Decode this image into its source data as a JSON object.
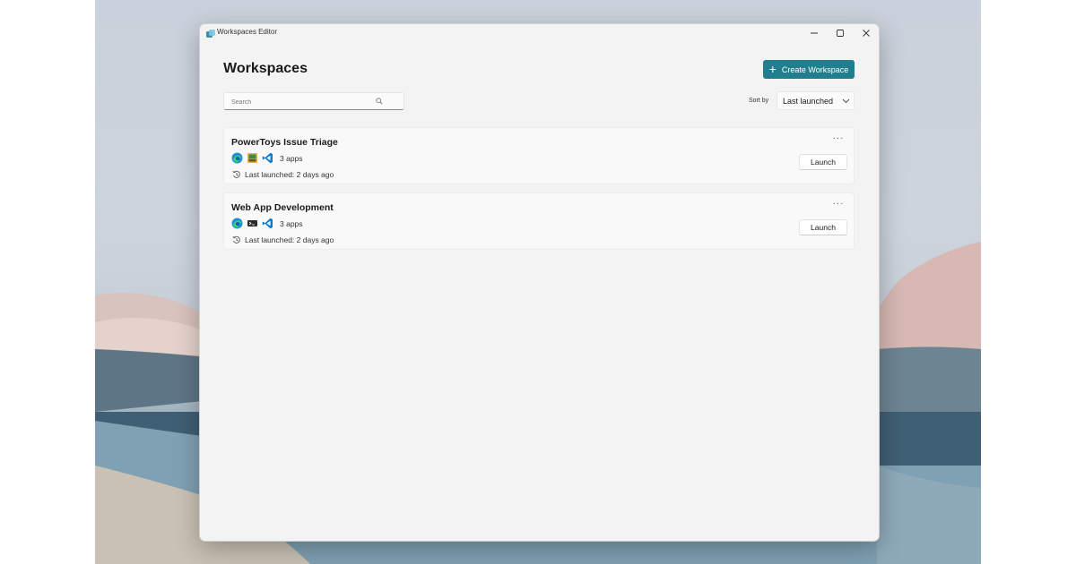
{
  "window": {
    "title": "Workspaces Editor"
  },
  "page": {
    "title": "Workspaces",
    "create_button_label": "Create Workspace"
  },
  "search": {
    "placeholder": "Search",
    "value": ""
  },
  "sort": {
    "label": "Sort by",
    "value": "Last launched"
  },
  "workspaces": [
    {
      "name": "PowerToys Issue Triage",
      "apps": [
        "edge-icon",
        "image-viewer-icon",
        "vscode-icon"
      ],
      "apps_count": "3 apps",
      "last_launched": "Last launched: 2 days ago",
      "launch_label": "Launch",
      "more_label": "···"
    },
    {
      "name": "Web App Development",
      "apps": [
        "edge-icon",
        "terminal-icon",
        "vscode-icon"
      ],
      "apps_count": "3 apps",
      "last_launched": "Last launched: 2 days ago",
      "launch_label": "Launch",
      "more_label": "···"
    }
  ],
  "colors": {
    "accent": "#1f7f8e",
    "window_bg": "#f3f3f3",
    "card_bg": "#f9f9f9"
  }
}
